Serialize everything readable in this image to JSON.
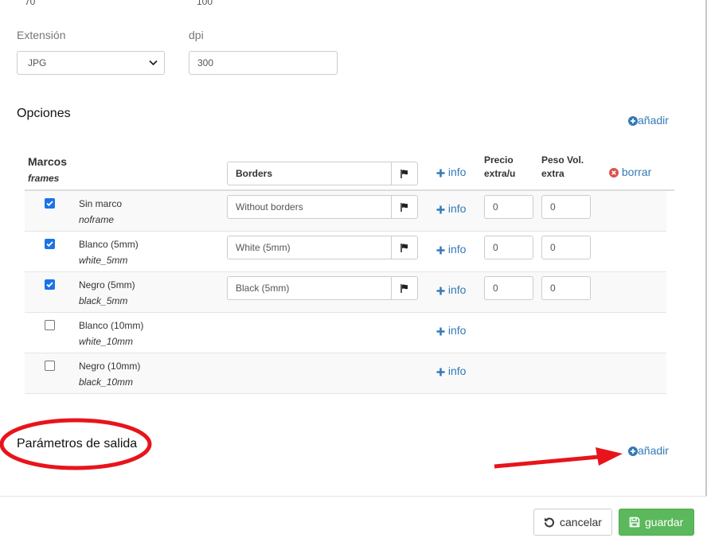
{
  "top_values": {
    "left": "70",
    "right": "100"
  },
  "format": {
    "extension_label": "Extensión",
    "extension_value": "JPG",
    "dpi_label": "dpi",
    "dpi_value": "300"
  },
  "options": {
    "title": "Opciones",
    "add_label": "añadir",
    "group": {
      "name": "Marcos",
      "key": "frames",
      "translation": "Borders",
      "info_label": "info",
      "price_header_1": "Precio",
      "price_header_2": "extra/u",
      "weight_header_1": "Peso Vol.",
      "weight_header_2": "extra",
      "delete_label": "borrar"
    },
    "rows": [
      {
        "label": "Sin marco",
        "key": "noframe",
        "checked": true,
        "translation": "Without borders",
        "price": "0",
        "weight": "0",
        "info": "info"
      },
      {
        "label": "Blanco (5mm)",
        "key": "white_5mm",
        "checked": true,
        "translation": "White (5mm)",
        "price": "0",
        "weight": "0",
        "info": "info"
      },
      {
        "label": "Negro (5mm)",
        "key": "black_5mm",
        "checked": true,
        "translation": "Black (5mm)",
        "price": "0",
        "weight": "0",
        "info": "info"
      },
      {
        "label": "Blanco (10mm)",
        "key": "white_10mm",
        "checked": false,
        "info": "info"
      },
      {
        "label": "Negro (10mm)",
        "key": "black_10mm",
        "checked": false,
        "info": "info"
      }
    ]
  },
  "output_params": {
    "title": "Parámetros de salida",
    "add_label": "añadir"
  },
  "footer": {
    "cancel_label": "cancelar",
    "save_label": "guardar"
  },
  "colors": {
    "link": "#337ab7",
    "success": "#5cb85c",
    "danger": "#d9534f",
    "annotation": "#e8141b",
    "checkbox": "#1a73e8"
  },
  "icons": {
    "add": "plus-circle-icon",
    "info": "plus-icon",
    "delete": "times-circle-icon",
    "translate": "flag-icon",
    "cancel": "undo-icon",
    "save": "floppy-disk-icon"
  }
}
